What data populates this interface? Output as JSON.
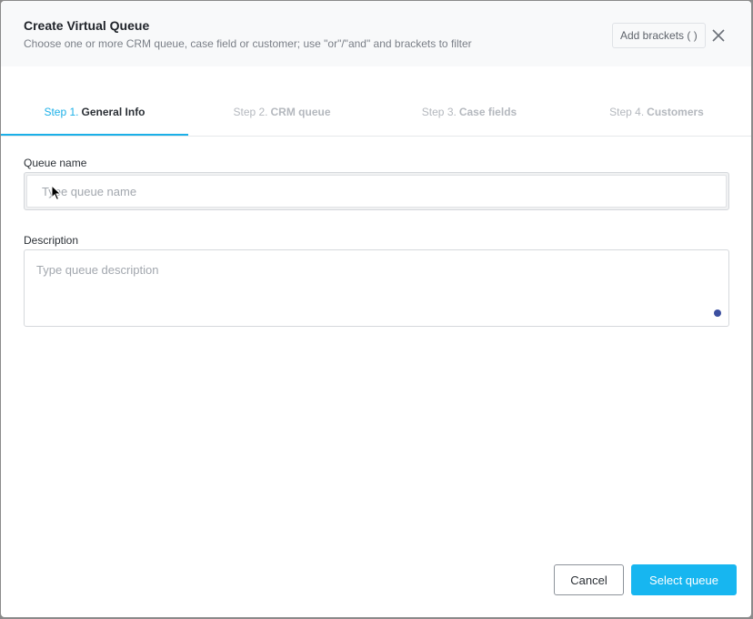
{
  "dialog": {
    "title": "Create Virtual Queue",
    "subtitle": "Choose one or more CRM queue, case field or customer; use \"or\"/\"and\" and brackets to filter",
    "add_brackets_label": "Add brackets ( )",
    "close_icon": "close-icon"
  },
  "tabs": [
    {
      "step": "Step 1.",
      "label": "General Info",
      "active": true
    },
    {
      "step": "Step 2.",
      "label": "CRM queue",
      "active": false
    },
    {
      "step": "Step 3.",
      "label": "Case fields",
      "active": false
    },
    {
      "step": "Step 4.",
      "label": "Customers",
      "active": false
    }
  ],
  "form": {
    "queue_name_label": "Queue name",
    "queue_name_value": "",
    "queue_name_placeholder": "Type queue name",
    "description_label": "Description",
    "description_value": "",
    "description_placeholder": "Type queue description"
  },
  "footer": {
    "cancel_label": "Cancel",
    "select_label": "Select queue"
  },
  "colors": {
    "accent": "#17b6f0",
    "active_tab": "#1bb0e8"
  }
}
